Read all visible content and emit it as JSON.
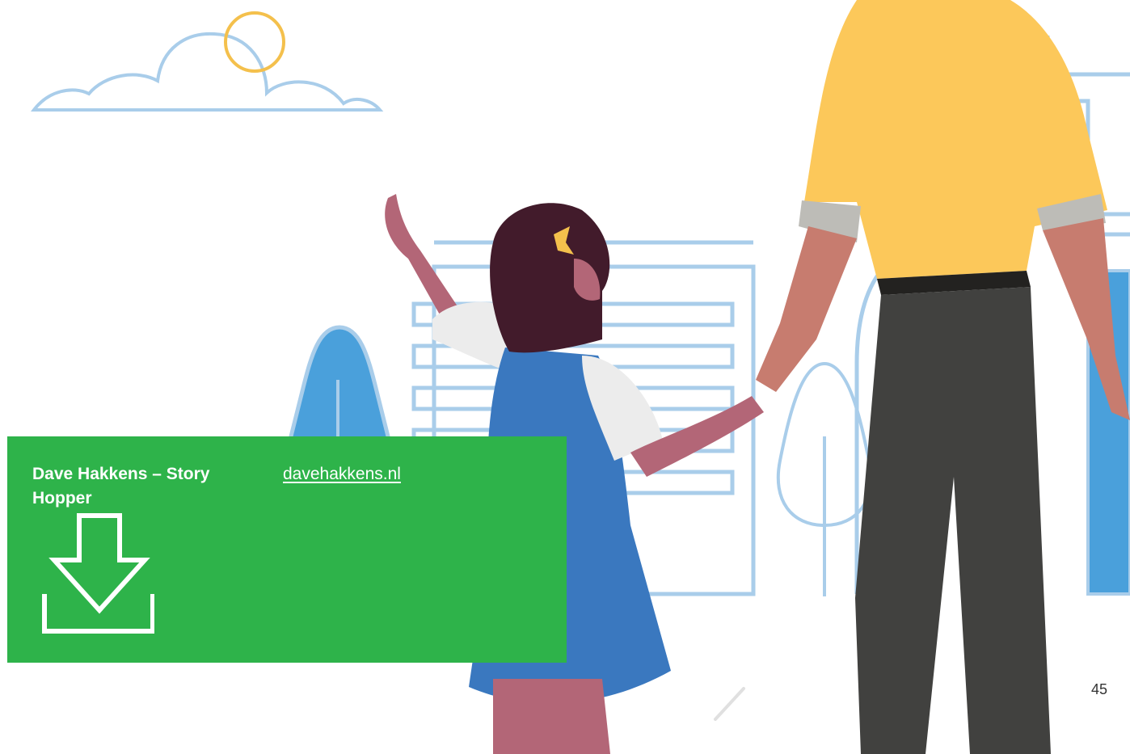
{
  "card": {
    "title": "Dave Hakkens – Story Hopper",
    "link_text": "davehakkens.nl",
    "download_icon": "download-icon",
    "color": "#2eb34a"
  },
  "page": {
    "number": "45"
  },
  "illustration": {
    "icon": "girl-and-adult-holding-hands",
    "colors": {
      "outline": "#a9cdea",
      "sun": "#f4c04c",
      "shirt": "#fcc85a",
      "dress": "#3a78bf",
      "pants": "#41413f"
    }
  }
}
